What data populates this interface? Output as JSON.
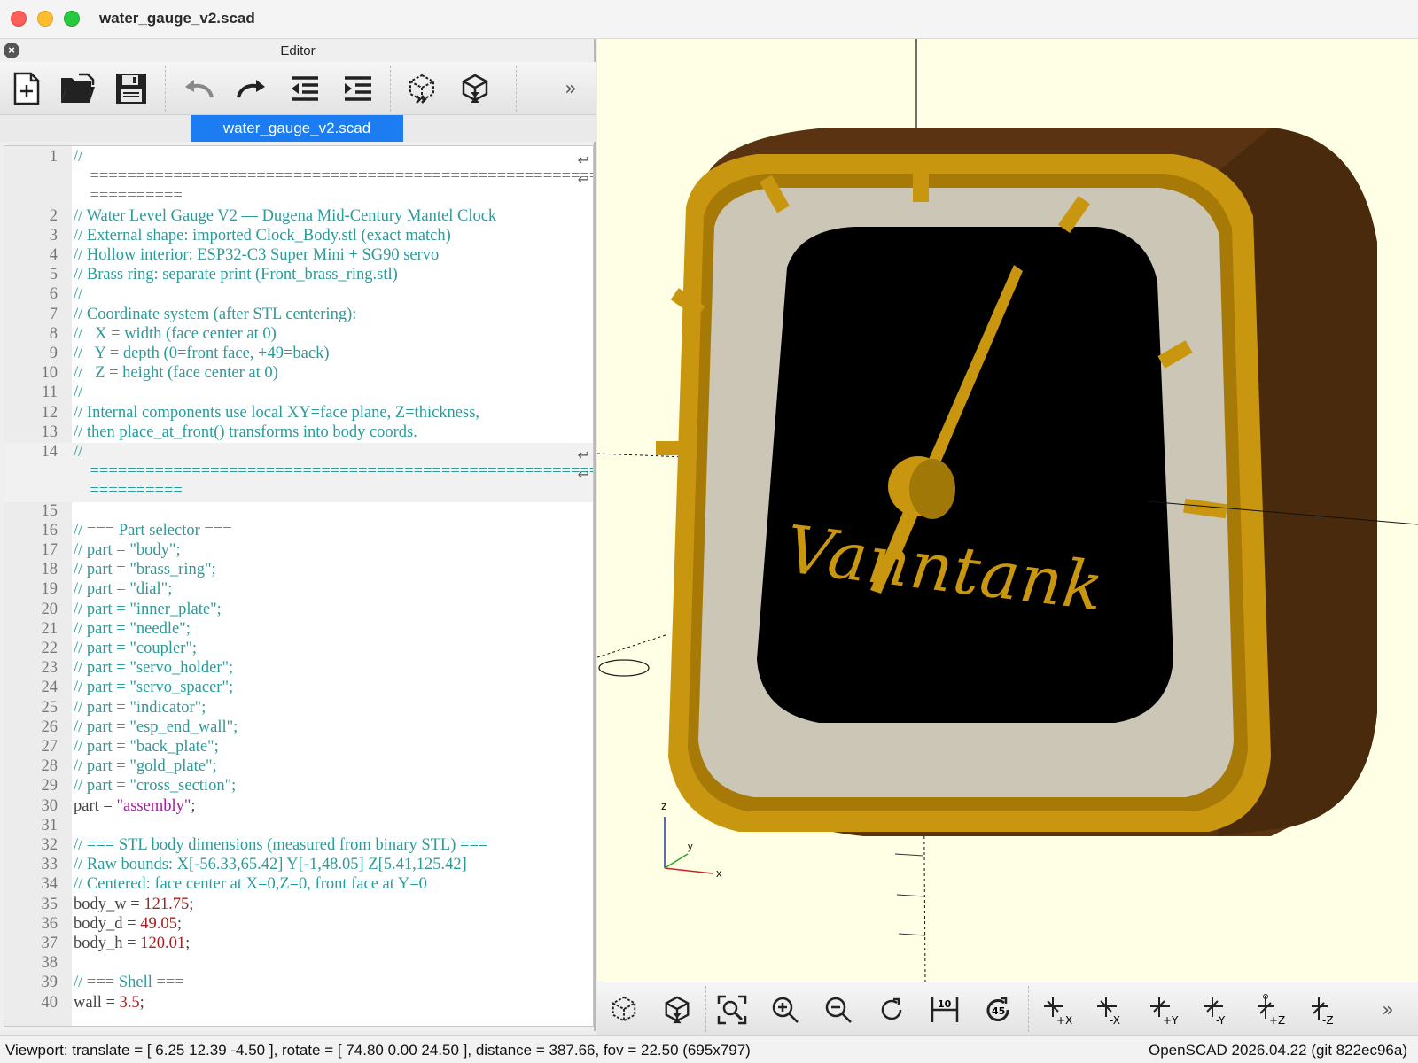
{
  "window": {
    "title": "water_gauge_v2.scad"
  },
  "editor": {
    "title": "Editor",
    "tab": "water_gauge_v2.scad",
    "toolbar": [
      "new-file",
      "open-file",
      "save-file",
      "undo",
      "redo",
      "unindent",
      "indent",
      "preview",
      "render",
      "more"
    ],
    "lines": [
      {
        "n": "1",
        "text": "//"
      },
      {
        "n": "",
        "text": "    ======================================================="
      },
      {
        "n": "",
        "text": "    =========="
      },
      {
        "n": "2",
        "text": "// Water Level Gauge V2 — Dugena Mid-Century Mantel Clock"
      },
      {
        "n": "3",
        "text": "// External shape: imported Clock_Body.stl (exact match)"
      },
      {
        "n": "4",
        "text": "// Hollow interior: ESP32-C3 Super Mini + SG90 servo"
      },
      {
        "n": "5",
        "text": "// Brass ring: separate print (Front_brass_ring.stl)"
      },
      {
        "n": "6",
        "text": "//"
      },
      {
        "n": "7",
        "text": "// Coordinate system (after STL centering):"
      },
      {
        "n": "8",
        "text": "//   X = width (face center at 0)"
      },
      {
        "n": "9",
        "text": "//   Y = depth (0=front face, +49=back)"
      },
      {
        "n": "10",
        "text": "//   Z = height (face center at 0)"
      },
      {
        "n": "11",
        "text": "//"
      },
      {
        "n": "12",
        "text": "// Internal components use local XY=face plane, Z=thickness,"
      },
      {
        "n": "13",
        "text": "// then place_at_front() transforms into body coords."
      },
      {
        "n": "14",
        "text": "//"
      },
      {
        "n": "",
        "text": "    ======================================================="
      },
      {
        "n": "",
        "text": "    =========="
      },
      {
        "n": "15",
        "text": ""
      },
      {
        "n": "16",
        "text": "// === Part selector ==="
      },
      {
        "n": "17",
        "text": "// part = \"body\";"
      },
      {
        "n": "18",
        "text": "// part = \"brass_ring\";"
      },
      {
        "n": "19",
        "text": "// part = \"dial\";"
      },
      {
        "n": "20",
        "text": "// part = \"inner_plate\";"
      },
      {
        "n": "21",
        "text": "// part = \"needle\";"
      },
      {
        "n": "22",
        "text": "// part = \"coupler\";"
      },
      {
        "n": "23",
        "text": "// part = \"servo_holder\";"
      },
      {
        "n": "24",
        "text": "// part = \"servo_spacer\";"
      },
      {
        "n": "25",
        "text": "// part = \"indicator\";"
      },
      {
        "n": "26",
        "text": "// part = \"esp_end_wall\";"
      },
      {
        "n": "27",
        "text": "// part = \"back_plate\";"
      },
      {
        "n": "28",
        "text": "// part = \"gold_plate\";"
      },
      {
        "n": "29",
        "text": "// part = \"cross_section\";"
      },
      {
        "n": "30",
        "code": "part",
        "op": " = ",
        "str": "\"assembly\"",
        "end": ";"
      },
      {
        "n": "31",
        "text": ""
      },
      {
        "n": "32",
        "text": "// === STL body dimensions (measured from binary STL) ==="
      },
      {
        "n": "33",
        "text": "// Raw bounds: X[-56.33,65.42] Y[-1,48.05] Z[5.41,125.42]"
      },
      {
        "n": "34",
        "text": "// Centered: face center at X=0,Z=0, front face at Y=0"
      },
      {
        "n": "35",
        "code": "body_w",
        "op": " = ",
        "num": "121.75",
        "end": ";"
      },
      {
        "n": "36",
        "code": "body_d",
        "op": " = ",
        "num": "49.05",
        "end": ";"
      },
      {
        "n": "37",
        "code": "body_h",
        "op": " = ",
        "num": "120.01",
        "end": ";"
      },
      {
        "n": "38",
        "text": ""
      },
      {
        "n": "39",
        "text": "// === Shell ==="
      },
      {
        "n": "40",
        "code": "wall",
        "op": " = ",
        "num": "3.5",
        "end": ";"
      }
    ]
  },
  "viewport": {
    "dial_text": "Vanntank",
    "axis_labels": [
      "z",
      "y",
      "x"
    ],
    "colors": {
      "background": "#ffffe5",
      "wood": "#5a3412",
      "brass": "#c9960f",
      "dial": "#cbc6b6",
      "face": "#000000"
    },
    "toolbar": [
      "preview",
      "render",
      "view-all",
      "zoom-in",
      "zoom-out",
      "reset-view",
      "ruler",
      "rotate-45",
      "view-right",
      "view-left",
      "view-back",
      "view-front",
      "view-top",
      "view-bottom",
      "more"
    ],
    "toolbar_labels": {
      "right": "+X",
      "left": "-X",
      "back": "+Y",
      "front": "-Y",
      "top": "+Z",
      "bottom": "-Z"
    }
  },
  "status": {
    "viewport": "Viewport: translate = [ 6.25 12.39 -4.50 ], rotate = [ 74.80 0.00 24.50 ], distance = 387.66, fov = 22.50 (695x797)",
    "version": "OpenSCAD 2026.04.22 (git 822ec96a)"
  }
}
